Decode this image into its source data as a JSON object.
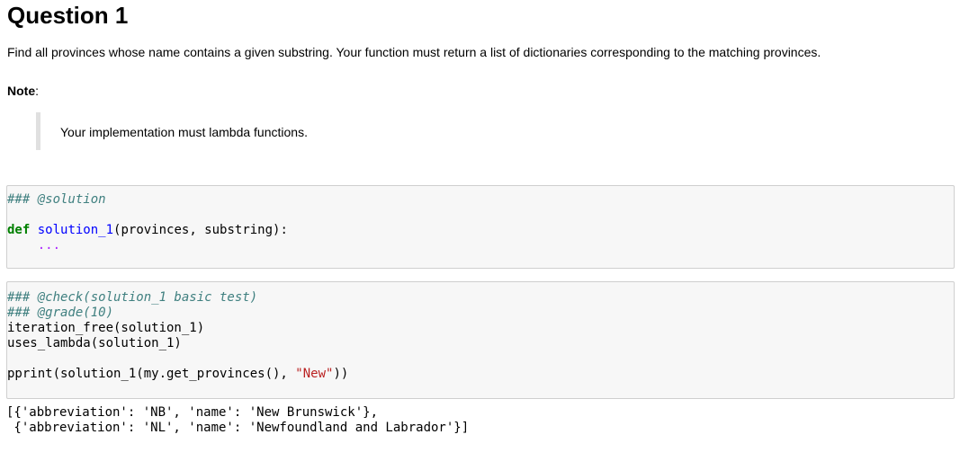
{
  "heading": "Question 1",
  "intro": "Find all provinces whose name contains a given substring. Your function must return a list of dictionaries corresponding to the matching provinces.",
  "note_label": "Note",
  "note_colon": ":",
  "quote": "Your implementation must lambda functions.",
  "cell1": {
    "comment": "### @solution",
    "def_kw": "def",
    "func_name": "solution_1",
    "signature_rest": "(provinces, substring):",
    "ellipsis": "    ..."
  },
  "cell2": {
    "comment1": "### @check(solution_1 basic test)",
    "comment2": "### @grade(10)",
    "line3": "iteration_free(solution_1)",
    "line4": "uses_lambda(solution_1)",
    "line6_pre": "pprint(solution_1(my.get_provinces(), ",
    "line6_str": "\"New\"",
    "line6_post": "))"
  },
  "output": {
    "line1": "[{'abbreviation': 'NB', 'name': 'New Brunswick'},",
    "line2": " {'abbreviation': 'NL', 'name': 'Newfoundland and Labrador'}]"
  }
}
